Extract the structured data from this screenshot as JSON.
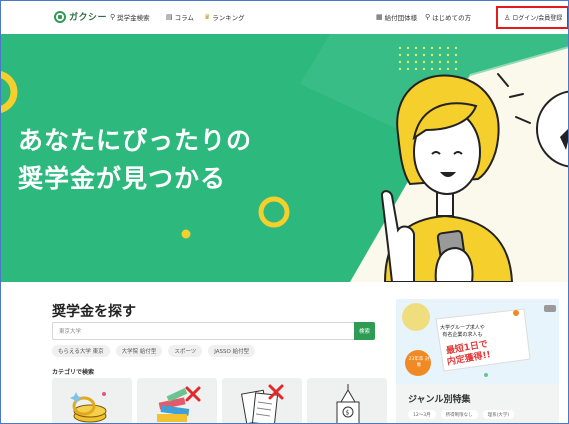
{
  "header": {
    "logo_text": "ガクシー",
    "nav": [
      {
        "label": "奨学金検索",
        "icon": "search-icon"
      },
      {
        "label": "コラム",
        "icon": "book-icon"
      },
      {
        "label": "ランキング",
        "icon": "crown-icon"
      }
    ],
    "right_nav": [
      {
        "label": "給付団体様",
        "icon": "building-icon"
      },
      {
        "label": "はじめての方",
        "icon": "pin-icon"
      }
    ],
    "login_label": "ログイン/会員登録"
  },
  "hero": {
    "title_line1": "あなたにぴったりの",
    "title_line2": "奨学金が見つかる"
  },
  "search_section": {
    "title": "奨学金を探す",
    "input_value": "東京大学",
    "button_label": "検索",
    "chips": [
      "もらえる大学 東京",
      "大学院 給付型",
      "スポーツ",
      "JASSO 給付型"
    ],
    "category_label": "カテゴリで検索"
  },
  "banner": {
    "text_line1": "大学グループ求人や",
    "text_line2": "有名企業の求人も",
    "big_line1": "最短1日で",
    "big_line2": "内定獲得!!",
    "badge": "23年卒 対象"
  },
  "genre": {
    "title": "ジャンル別特集",
    "chips": [
      "12〜3月",
      "所得制限なし",
      "理系(大学)"
    ]
  },
  "colors": {
    "brand_green": "#2e9c52",
    "hero_green": "#2db87e",
    "accent_yellow": "#f5cf2b",
    "login_border": "#e21a1a"
  }
}
